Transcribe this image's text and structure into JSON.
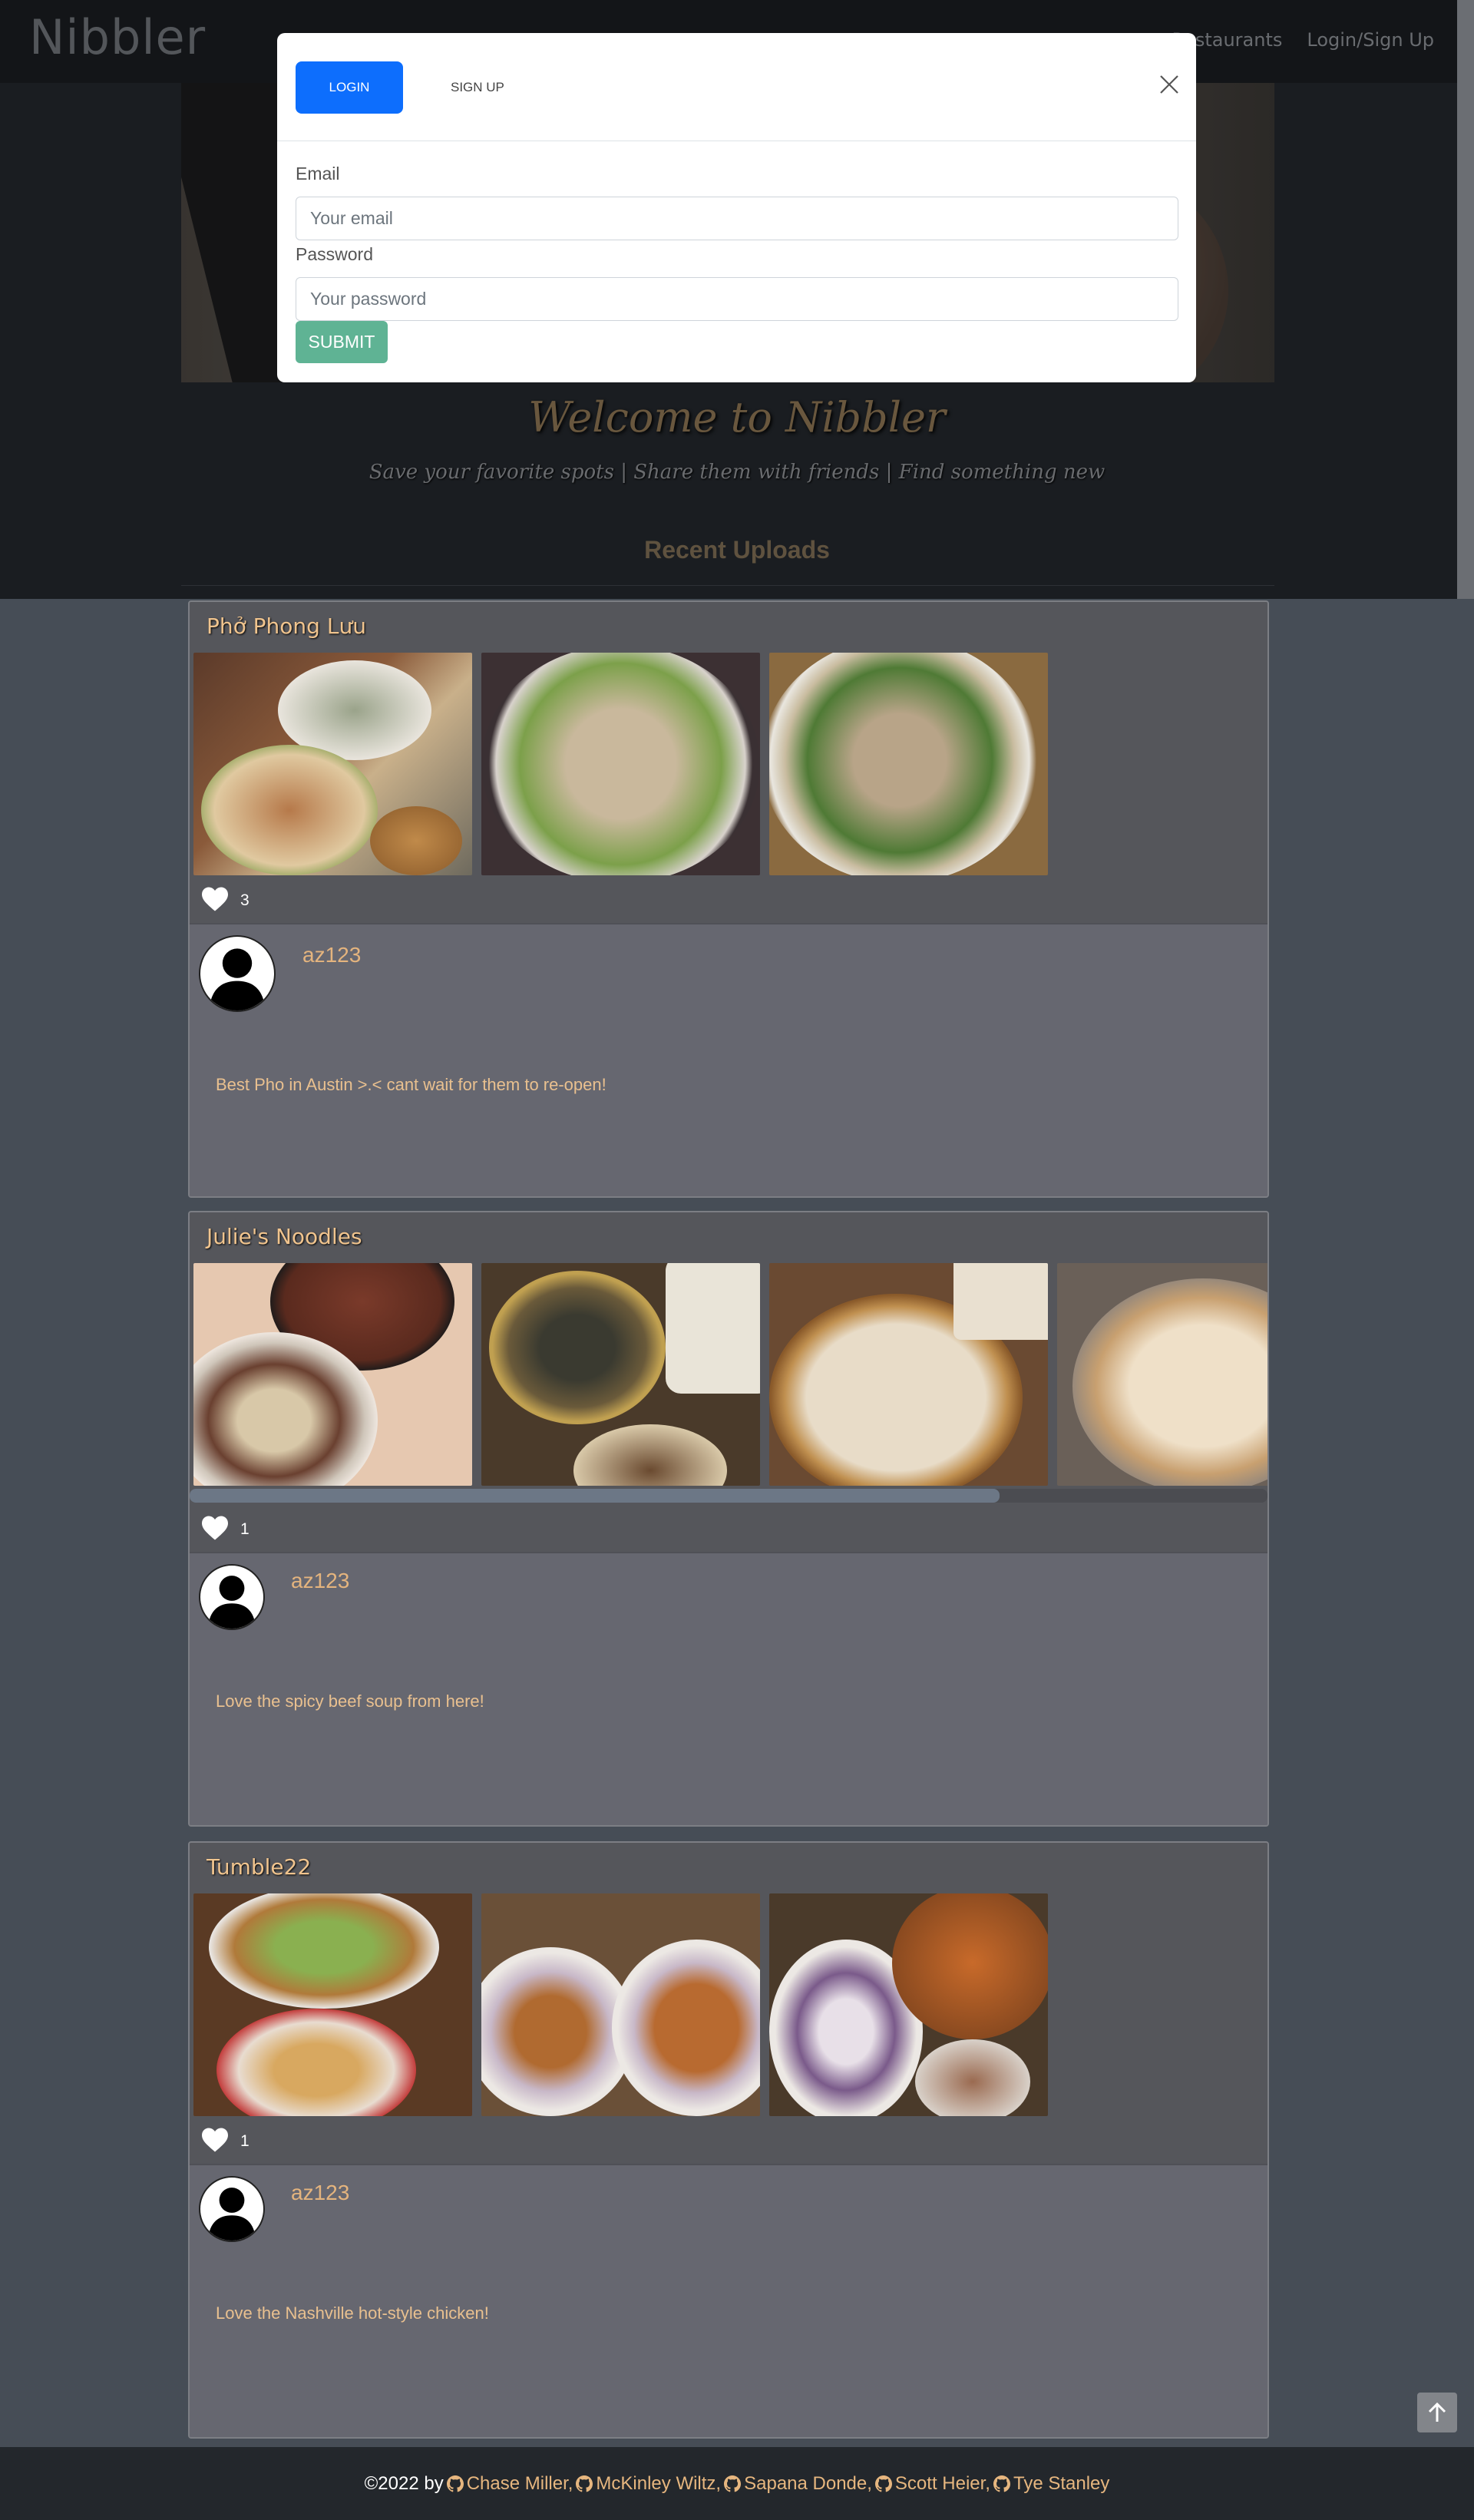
{
  "nav": {
    "brand": "Nibbler",
    "links": [
      "Restaurants",
      "Login/Sign Up"
    ]
  },
  "hero": {
    "title": "Welcome to Nibbler",
    "subtitle": "Save your favorite spots | Share them with friends | Find something new",
    "section_title": "Recent Uploads"
  },
  "modal": {
    "tab_login": "LOGIN",
    "tab_signup": "SIGN UP",
    "email_label": "Email",
    "email_placeholder": "Your email",
    "password_label": "Password",
    "password_placeholder": "Your password",
    "submit_label": "SUBMIT"
  },
  "posts": [
    {
      "restaurant": "Phở Phong Lưu",
      "likes": "3",
      "user": "az123",
      "text": "Best Pho in Austin >.< cant wait for them to re-open!",
      "photo_count": 3
    },
    {
      "restaurant": "Julie's Noodles",
      "likes": "1",
      "user": "az123",
      "text": "Love the spicy beef soup from here!",
      "photo_count": 4
    },
    {
      "restaurant": "Tumble22",
      "likes": "1",
      "user": "az123",
      "text": "Love the Nashville hot-style chicken!",
      "photo_count": 3
    }
  ],
  "footer": {
    "prefix": "©2022 by",
    "authors": [
      "Chase Miller,",
      "McKinley Wiltz,",
      "Sapana Donde,",
      "Scott Heier,",
      "Tye Stanley"
    ]
  },
  "colors": {
    "brand_blue": "#0d6efd",
    "submit_green": "#5fb394",
    "accent_gold": "#e6b67f"
  }
}
